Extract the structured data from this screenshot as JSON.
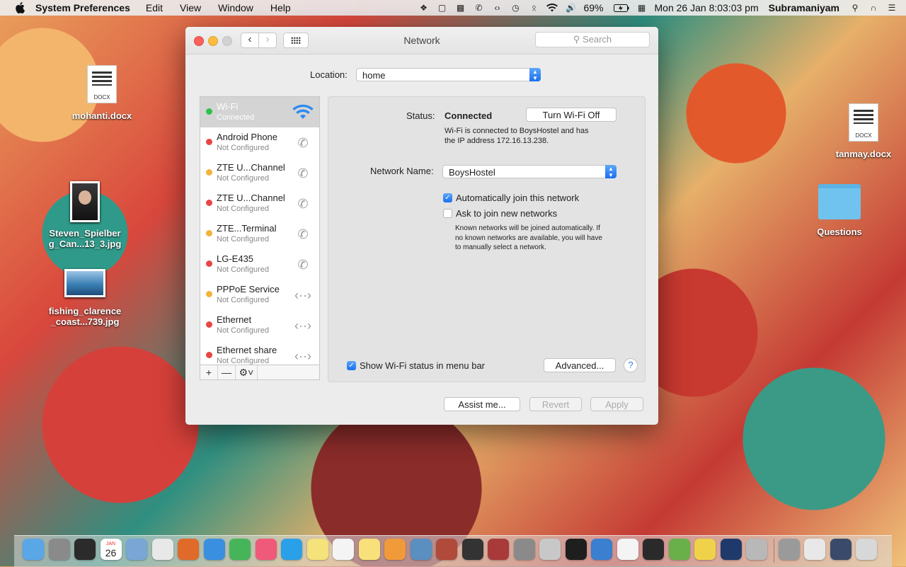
{
  "menubar": {
    "app_name": "System Preferences",
    "menus": [
      "Edit",
      "View",
      "Window",
      "Help"
    ],
    "battery": "69%",
    "clock": "Mon 26 Jan  8:03:03 pm",
    "user": "Subramaniyam"
  },
  "desktop": {
    "items": [
      {
        "label": "mohanti.docx",
        "tag": "DOCX"
      },
      {
        "label_line1": "Steven_Spielber",
        "label_line2": "g_Can...13_3.jpg"
      },
      {
        "label_line1": "fishing_clarence",
        "label_line2": "_coast...739.jpg"
      },
      {
        "label": "tanmay.docx",
        "tag": "DOCX"
      },
      {
        "label": "Questions"
      }
    ]
  },
  "window": {
    "title": "Network",
    "search_placeholder": "Search",
    "location_label": "Location:",
    "location_value": "home"
  },
  "services": [
    {
      "name": "Wi-Fi",
      "status": "Connected",
      "dot": "#2ec24a",
      "icon": "wifi-icon",
      "selected": true
    },
    {
      "name": "Android Phone",
      "status": "Not Configured",
      "dot": "#e84545",
      "icon": "phone-icon"
    },
    {
      "name": "ZTE U...Channel",
      "status": "Not Configured",
      "dot": "#f3b23a",
      "icon": "phone-icon"
    },
    {
      "name": "ZTE U...Channel",
      "status": "Not Configured",
      "dot": "#e84545",
      "icon": "phone-icon"
    },
    {
      "name": "ZTE...Terminal",
      "status": "Not Configured",
      "dot": "#f3b23a",
      "icon": "phone-icon"
    },
    {
      "name": "LG-E435",
      "status": "Not Configured",
      "dot": "#e84545",
      "icon": "phone-icon"
    },
    {
      "name": "PPPoE Service",
      "status": "Not Configured",
      "dot": "#f3b23a",
      "icon": "ethernet-icon"
    },
    {
      "name": "Ethernet",
      "status": "Not Configured",
      "dot": "#e84545",
      "icon": "ethernet-icon"
    },
    {
      "name": "Ethernet share",
      "status": "Not Configured",
      "dot": "#e84545",
      "icon": "ethernet-icon"
    }
  ],
  "detail": {
    "status_label": "Status:",
    "status_value": "Connected",
    "turn_off_label": "Turn Wi-Fi Off",
    "status_desc_1": "Wi-Fi is connected to BoysHostel and has",
    "status_desc_2": "the IP address 172.16.13.238.",
    "network_name_label": "Network Name:",
    "network_name_value": "BoysHostel",
    "auto_join_label": "Automatically join this network",
    "auto_join_checked": true,
    "ask_join_label": "Ask to join new networks",
    "ask_join_checked": false,
    "ask_desc_1": "Known networks will be joined automatically. If",
    "ask_desc_2": "no known networks are available, you will have",
    "ask_desc_3": "to manually select a network.",
    "show_status_label": "Show Wi-Fi status in menu bar",
    "show_status_checked": true,
    "advanced_label": "Advanced...",
    "help_label": "?"
  },
  "footer": {
    "assist_label": "Assist me...",
    "revert_label": "Revert",
    "apply_label": "Apply"
  },
  "dock": {
    "calendar_day": "26",
    "calendar_month": "JAN",
    "apps": [
      "finder-icon",
      "launchpad-icon",
      "photo-booth-icon",
      "calendar-icon",
      "preview-icon",
      "chrome-icon",
      "firefox-icon",
      "safari-icon",
      "facetime-icon",
      "itunes-icon",
      "skype-icon",
      "stickies-icon",
      "textedit-icon",
      "notes-icon",
      "ibooks-icon",
      "iphoto-icon",
      "photo-slideshow-icon",
      "radiation-icon",
      "dictionary-icon",
      "system-preferences-icon",
      "preview2-icon",
      "terminal-icon",
      "xcode-icon",
      "pages-icon",
      "activity-monitor-icon",
      "utorrent-icon",
      "paint-icon",
      "photoshop-icon",
      "image-capture-icon"
    ]
  }
}
